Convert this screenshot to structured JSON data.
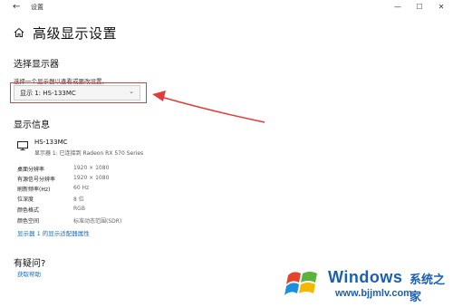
{
  "window": {
    "back_glyph": "←",
    "title": "设置",
    "min_glyph": "—",
    "max_glyph": "☐",
    "close_glyph": "✕"
  },
  "header": {
    "title": "高级显示设置",
    "home_icon": "home-icon"
  },
  "select_display": {
    "section_title": "选择显示器",
    "hint": "选择一个显示器以查看或更改设置。",
    "dropdown_value": "显示 1: HS-133MC",
    "chevron_glyph": "⌄"
  },
  "display_info": {
    "section_title": "显示信息",
    "monitor_name": "HS-133MC",
    "monitor_desc": "显示器 1: 已连接到 Radeon RX 570 Series",
    "rows": [
      {
        "key": "桌面分辨率",
        "value": "1920 × 1080"
      },
      {
        "key": "有源信号分辨率",
        "value": "1920 × 1080"
      },
      {
        "key": "刷新频率(Hz)",
        "value": "60 Hz"
      },
      {
        "key": "位深度",
        "value": "8 位"
      },
      {
        "key": "颜色格式",
        "value": "RGB"
      },
      {
        "key": "颜色空间",
        "value": "标准动态范围(SDR)"
      }
    ],
    "adapter_link": "显示器 1 的显示适配器属性"
  },
  "help": {
    "section_title": "有疑问?",
    "link": "获取帮助"
  },
  "accent_color": "#e23b3b",
  "link_color": "#1a6fc4",
  "watermark": {
    "brand": "Windows",
    "brand_cn": "系统之家",
    "url": "www.bjjmlv.com"
  }
}
